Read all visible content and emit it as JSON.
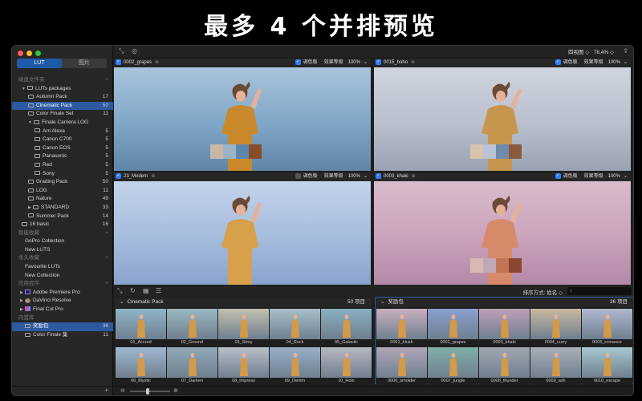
{
  "headline": "最多 4 个并排预览",
  "sidebar": {
    "tabs": [
      "LUT",
      "图片"
    ],
    "sections": {
      "disk": "磁盘文件夹",
      "smart": "智能收藏",
      "permanent": "永久收藏",
      "apps": "应用程序",
      "builtin": "内置库"
    },
    "disk_items": [
      {
        "label": "LUTs packages",
        "count": "",
        "level": 1,
        "kind": "folder-open"
      },
      {
        "label": "Autumn Pack",
        "count": "17",
        "level": 2,
        "kind": "folder"
      },
      {
        "label": "Cinematic Pack",
        "count": "50",
        "level": 2,
        "kind": "folder",
        "selected": true
      },
      {
        "label": "Color Finale Set",
        "count": "11",
        "level": 2,
        "kind": "folder"
      },
      {
        "label": "Finale Camera LOG",
        "count": "",
        "level": 2,
        "kind": "folder-open"
      },
      {
        "label": "Arri Alexa",
        "count": "5",
        "level": 3,
        "kind": "folder"
      },
      {
        "label": "Canon C700",
        "count": "5",
        "level": 3,
        "kind": "folder"
      },
      {
        "label": "Canon EOS",
        "count": "5",
        "level": 3,
        "kind": "folder"
      },
      {
        "label": "Panasonic",
        "count": "5",
        "level": 3,
        "kind": "folder"
      },
      {
        "label": "Red",
        "count": "5",
        "level": 3,
        "kind": "folder"
      },
      {
        "label": "Sony",
        "count": "5",
        "level": 3,
        "kind": "folder"
      },
      {
        "label": "Grading Pack",
        "count": "50",
        "level": 2,
        "kind": "folder"
      },
      {
        "label": "LOG",
        "count": "11",
        "level": 2,
        "kind": "folder"
      },
      {
        "label": "Nature",
        "count": "49",
        "level": 2,
        "kind": "folder"
      },
      {
        "label": "STANDARD",
        "count": "33",
        "level": 2,
        "kind": "folder-closed"
      },
      {
        "label": "Summer Pack",
        "count": "14",
        "level": 2,
        "kind": "folder"
      },
      {
        "label": "16 basic",
        "count": "16",
        "level": 1,
        "kind": "folder"
      }
    ],
    "smart_items": [
      {
        "label": "GoPro Collection"
      },
      {
        "label": "New LUTS"
      }
    ],
    "permanent_items": [
      {
        "label": "Favourite LUTs"
      },
      {
        "label": "New Collection"
      }
    ],
    "app_items": [
      {
        "label": "Adobe Premiere Pro"
      },
      {
        "label": "DaVinci Resolve"
      },
      {
        "label": "Final Cut Pro"
      }
    ],
    "builtin_items": [
      {
        "label": "奖励包",
        "count": "36",
        "selected": true
      },
      {
        "label": "Color Finale 集",
        "count": "11"
      }
    ]
  },
  "toolbar": {
    "view_mode": "四视图 ◇",
    "zoom": "78,4% ◇"
  },
  "previews": [
    {
      "name": "0002_grapes",
      "color_label": "调色板",
      "effect_label": "效果等级",
      "effect_value": "100%",
      "palette_on": true
    },
    {
      "name": "0015_boho",
      "color_label": "调色板",
      "effect_label": "效果等级",
      "effect_value": "100%",
      "palette_on": true
    },
    {
      "name": "23_Modern",
      "color_label": "调色板",
      "effect_label": "效果等级",
      "effect_value": "100%",
      "palette_on": false
    },
    {
      "name": "0003_khaki",
      "color_label": "调色板",
      "effect_label": "效果等级",
      "effect_value": "100%",
      "palette_on": true
    }
  ],
  "sort": {
    "label": "排序方式:",
    "value": "姓名 ◇"
  },
  "galleries": [
    {
      "title": "Cinematic Pack",
      "count": "50 项目",
      "items": [
        "01_Accord",
        "02_Ground",
        "03_Story",
        "04_Rock",
        "05_Galactic",
        "06_Mystic",
        "07_Darken",
        "08_Impress",
        "09_Denim",
        "10_Holo"
      ]
    },
    {
      "title": "奖励包",
      "count": "36 项目",
      "items": [
        "0001_blush",
        "0002_grapes",
        "0003_khaki",
        "0004_curry",
        "0005_romance",
        "0006_smolder",
        "0007_jungle",
        "0008_thunder",
        "0009_ash",
        "0010_escape"
      ]
    }
  ],
  "colors": {
    "accent": "#2d5aa0",
    "checkbox": "#2f7cf6"
  }
}
